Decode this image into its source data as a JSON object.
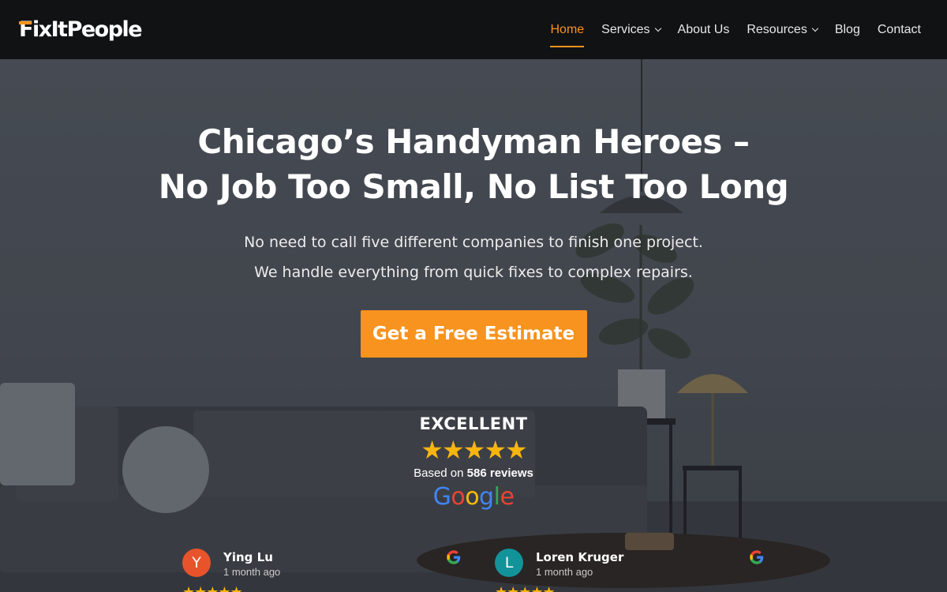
{
  "header": {
    "logo_text": "FixItPeople",
    "nav": [
      {
        "label": "Home",
        "active": true,
        "dropdown": false
      },
      {
        "label": "Services",
        "active": false,
        "dropdown": true
      },
      {
        "label": "About Us",
        "active": false,
        "dropdown": false
      },
      {
        "label": "Resources",
        "active": false,
        "dropdown": true
      },
      {
        "label": "Blog",
        "active": false,
        "dropdown": false
      },
      {
        "label": "Contact",
        "active": false,
        "dropdown": false
      }
    ]
  },
  "hero": {
    "headline_line1": "Chicago’s Handyman Heroes –",
    "headline_line2": "No Job Too Small, No List Too Long",
    "sub_line1": "No need to call five different companies to finish one project.",
    "sub_line2": "We handle everything from quick fixes to complex repairs.",
    "cta_label": "Get a Free Estimate"
  },
  "rating": {
    "label": "EXCELLENT",
    "stars": "★★★★★",
    "based_prefix": "Based on",
    "review_count": "586 reviews",
    "source": "Google"
  },
  "reviews": [
    {
      "initial": "Y",
      "name": "Ying Lu",
      "time": "1 month ago",
      "avatar_color": "#e8532b",
      "stars": "★★★★★"
    },
    {
      "initial": "L",
      "name": "Loren Kruger",
      "time": "1 month ago",
      "avatar_color": "#12939a",
      "stars": "★★★★★"
    }
  ],
  "colors": {
    "accent": "#f7931e",
    "header_bg": "#111214",
    "star": "#f9b50f"
  }
}
